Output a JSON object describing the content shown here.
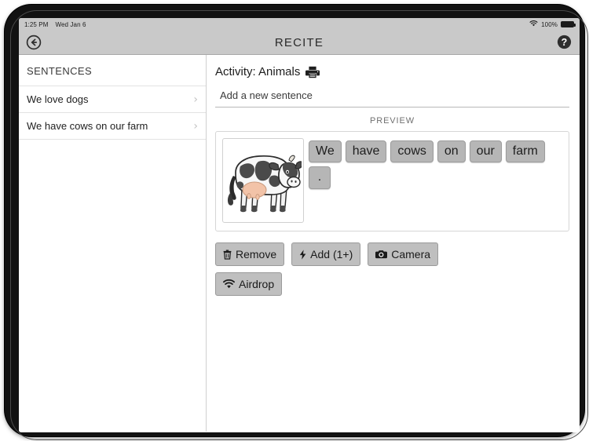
{
  "status_bar": {
    "time": "1:25 PM",
    "date": "Wed Jan 6",
    "wifi_icon": "wifi-icon",
    "battery_percent": "100%",
    "battery_icon": "battery-full-icon"
  },
  "nav_bar": {
    "back_icon": "back-circle-arrow-icon",
    "title": "RECITE",
    "help_icon": "help-question-circle-icon"
  },
  "sidebar": {
    "header": "SENTENCES",
    "items": [
      {
        "label": "We love dogs",
        "chevron": "chevron-right-icon"
      },
      {
        "label": "We have cows on our farm",
        "chevron": "chevron-right-icon"
      }
    ]
  },
  "content": {
    "activity_title": "Activity: Animals",
    "print_icon": "printer-icon",
    "new_sentence_placeholder": "Add a new sentence",
    "new_sentence_value": "",
    "preview_label": "PREVIEW",
    "preview": {
      "image_alt": "cow-illustration",
      "tiles": [
        "We",
        "have",
        "cows",
        "on",
        "our",
        "farm",
        "."
      ]
    },
    "buttons": [
      {
        "label": "Remove",
        "icon": "trash-icon"
      },
      {
        "label": "Add (1+)",
        "icon": "lightning-bolt-icon"
      },
      {
        "label": "Camera",
        "icon": "camera-icon"
      },
      {
        "label": "Airdrop",
        "icon": "airdrop-wifi-icon"
      }
    ]
  },
  "colors": {
    "chrome_gray": "#c9c9c9",
    "tile_gray": "#b6b6b6",
    "button_gray": "#bfbfbf",
    "bezel_black": "#121212"
  }
}
